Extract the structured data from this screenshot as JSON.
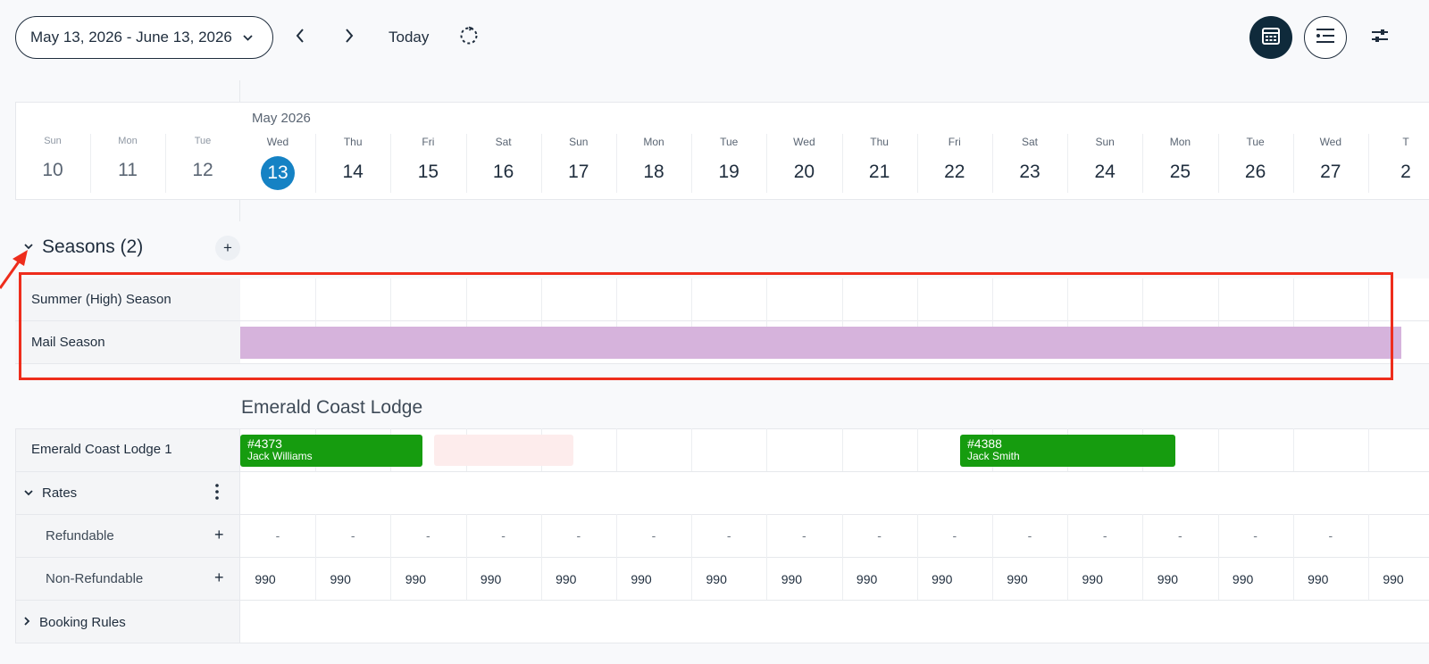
{
  "toolbar": {
    "date_range": "May 13, 2026 - June 13, 2026",
    "today_label": "Today",
    "icons": [
      "chevron-down-icon",
      "chevron-left-icon",
      "chevron-right-icon",
      "refresh-icon",
      "calendar-view-icon",
      "list-view-icon",
      "filter-sliders-icon"
    ]
  },
  "calendar": {
    "month_label": "May 2026",
    "past_days": [
      {
        "name": "Sun",
        "num": "10"
      },
      {
        "name": "Mon",
        "num": "11"
      },
      {
        "name": "Tue",
        "num": "12"
      }
    ],
    "days": [
      {
        "name": "Wed",
        "num": "13"
      },
      {
        "name": "Thu",
        "num": "14"
      },
      {
        "name": "Fri",
        "num": "15"
      },
      {
        "name": "Sat",
        "num": "16"
      },
      {
        "name": "Sun",
        "num": "17"
      },
      {
        "name": "Mon",
        "num": "18"
      },
      {
        "name": "Tue",
        "num": "19"
      },
      {
        "name": "Wed",
        "num": "20"
      },
      {
        "name": "Thu",
        "num": "21"
      },
      {
        "name": "Fri",
        "num": "22"
      },
      {
        "name": "Sat",
        "num": "23"
      },
      {
        "name": "Sun",
        "num": "24"
      },
      {
        "name": "Mon",
        "num": "25"
      },
      {
        "name": "Tue",
        "num": "26"
      },
      {
        "name": "Wed",
        "num": "27"
      },
      {
        "name": "T",
        "num": "2"
      }
    ],
    "today_num": "13"
  },
  "seasons": {
    "title": "Seasons (2)",
    "add_label": "+",
    "items": [
      {
        "label": "Summer (High) Season"
      },
      {
        "label": "Mail Season"
      }
    ],
    "mail_season_color": "#d6b3dc"
  },
  "lodge": {
    "title": "Emerald Coast Lodge",
    "unit_label": "Emerald Coast Lodge 1",
    "bookings": [
      {
        "id": "#4373",
        "guest": "Jack Williams",
        "color": "#169c0f"
      },
      {
        "id": "#4388",
        "guest": "Jack Smith",
        "color": "#169c0f"
      }
    ],
    "rates_label": "Rates",
    "refundable_label": "Refundable",
    "non_refundable_label": "Non-Refundable",
    "refundable_values": [
      "-",
      "-",
      "-",
      "-",
      "-",
      "-",
      "-",
      "-",
      "-",
      "-",
      "-",
      "-",
      "-",
      "-",
      "-"
    ],
    "non_refundable_values": [
      "990",
      "990",
      "990",
      "990",
      "990",
      "990",
      "990",
      "990",
      "990",
      "990",
      "990",
      "990",
      "990",
      "990",
      "990",
      "990"
    ],
    "booking_rules_label": "Booking Rules",
    "plus": "+"
  }
}
